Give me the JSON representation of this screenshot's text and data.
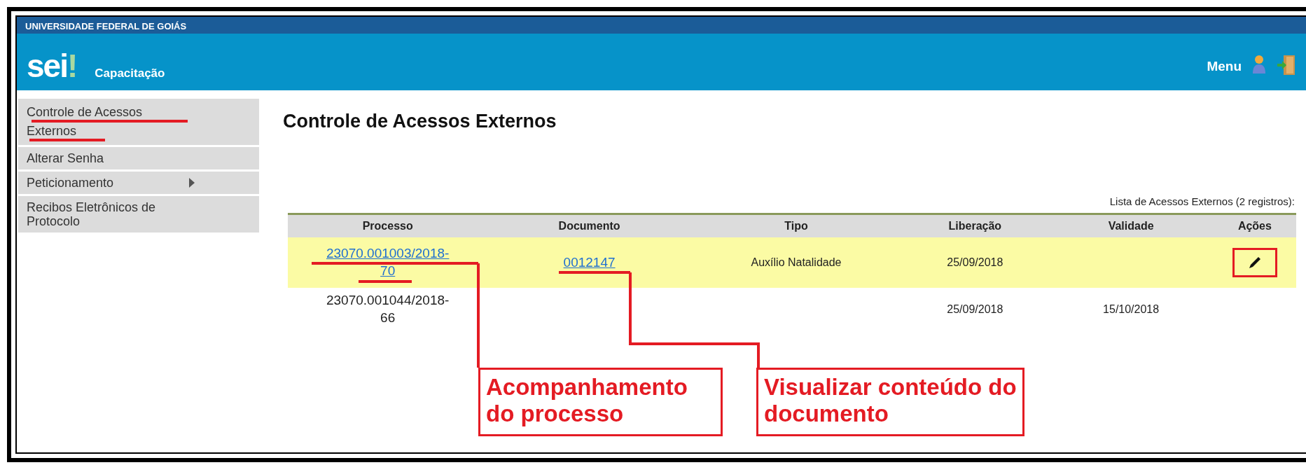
{
  "institution": "UNIVERSIDADE FEDERAL DE GOIÁS",
  "header": {
    "logo": "sei!",
    "environment": "Capacitação",
    "menu_label": "Menu"
  },
  "sidebar": {
    "items": [
      {
        "label": "Controle de Acessos Externos",
        "has_submenu": false
      },
      {
        "label": "Alterar Senha",
        "has_submenu": false
      },
      {
        "label": "Peticionamento",
        "has_submenu": true
      },
      {
        "label": "Recibos Eletrônicos de Protocolo",
        "has_submenu": false
      }
    ]
  },
  "page_title": "Controle de Acessos Externos",
  "table": {
    "caption": "Lista de Acessos Externos (2 registros):",
    "columns": [
      "Processo",
      "Documento",
      "Tipo",
      "Liberação",
      "Validade",
      "Ações"
    ],
    "rows": [
      {
        "highlighted": true,
        "processo": "23070.001003/2018-70",
        "processo_link": true,
        "documento": "0012147",
        "tipo": "Auxílio Natalidade",
        "liberacao": "25/09/2018",
        "validade": "",
        "has_action": true
      },
      {
        "highlighted": false,
        "processo": "23070.001044/2018-66",
        "processo_link": false,
        "documento": "",
        "tipo": "",
        "liberacao": "25/09/2018",
        "validade": "15/10/2018",
        "has_action": false
      }
    ]
  },
  "annotations": [
    {
      "text": "Acompanhamento do processo"
    },
    {
      "text": "Visualizar conteúdo do documento"
    }
  ]
}
